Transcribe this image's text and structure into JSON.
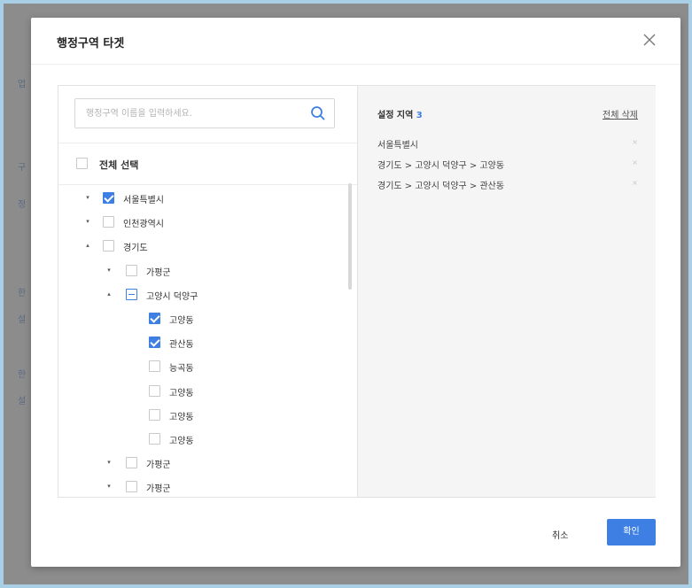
{
  "background": {
    "fragments": [
      "업",
      "구",
      "정",
      "한",
      "설",
      "한",
      "설"
    ]
  },
  "modal": {
    "title": "행정구역 타겟",
    "close_icon": "close-icon"
  },
  "search": {
    "placeholder": "행정구역 이름을 입력하세요.",
    "value": "",
    "icon": "search-icon"
  },
  "select_all": {
    "label": "전체 선택",
    "checked": false
  },
  "tree": [
    {
      "label": "서울특별시",
      "state": "checked",
      "caret": "▾",
      "level": 0
    },
    {
      "label": "인천광역시",
      "state": "unchecked",
      "caret": "▾",
      "level": 0
    },
    {
      "label": "경기도",
      "state": "unchecked",
      "caret": "▴",
      "level": 0
    },
    {
      "label": "가평군",
      "state": "unchecked",
      "caret": "▾",
      "level": 1
    },
    {
      "label": "고양시 덕양구",
      "state": "partial",
      "caret": "▴",
      "level": 1
    },
    {
      "label": "고양동",
      "state": "checked",
      "caret": "",
      "level": 2
    },
    {
      "label": "관산동",
      "state": "checked",
      "caret": "",
      "level": 2
    },
    {
      "label": "능곡동",
      "state": "unchecked",
      "caret": "",
      "level": 2
    },
    {
      "label": "고양동",
      "state": "unchecked",
      "caret": "",
      "level": 2
    },
    {
      "label": "고양동",
      "state": "unchecked",
      "caret": "",
      "level": 2
    },
    {
      "label": "고양동",
      "state": "unchecked",
      "caret": "",
      "level": 2
    },
    {
      "label": "가평군",
      "state": "unchecked",
      "caret": "▾",
      "level": 1
    },
    {
      "label": "가평군",
      "state": "unchecked",
      "caret": "▾",
      "level": 1
    }
  ],
  "selected": {
    "heading": "설정 지역",
    "count": "3",
    "clear_all_label": "전체 삭제",
    "items": [
      {
        "label": "서울특별시",
        "remove": "×"
      },
      {
        "label": "경기도 > 고양시 덕양구 > 고양동",
        "remove": "×"
      },
      {
        "label": "경기도 > 고양시 덕양구 > 관산동",
        "remove": "×"
      }
    ]
  },
  "footer": {
    "cancel_label": "취소",
    "confirm_label": "확인"
  },
  "colors": {
    "accent": "#3e7fe3",
    "frame": "#a9cfe6",
    "backdrop": "#8c8c8c"
  }
}
